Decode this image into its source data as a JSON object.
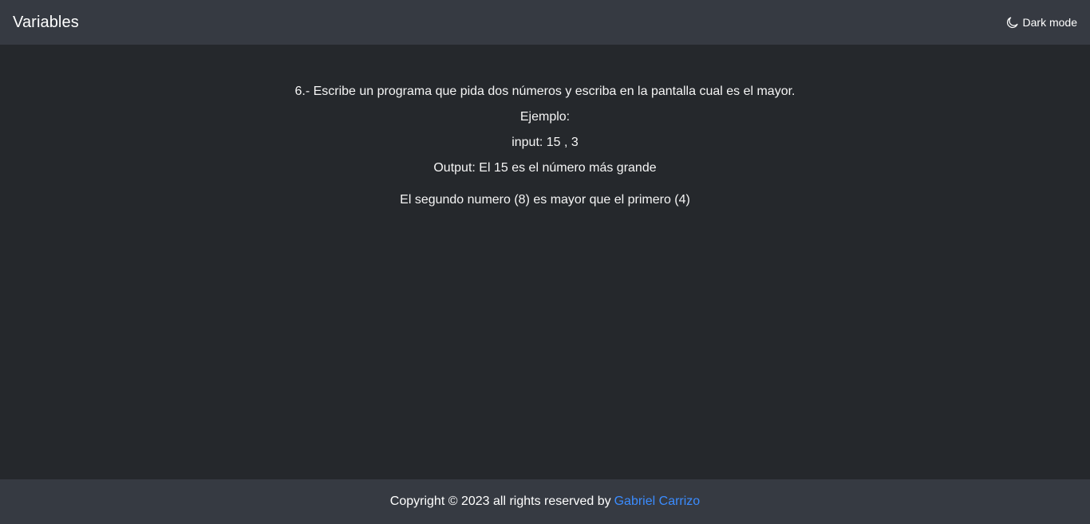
{
  "header": {
    "brand": "Variables",
    "mode_toggle_label": "Dark mode",
    "mode_icon": "moon-icon"
  },
  "main": {
    "statement": "6.- Escribe un programa que pida dos números y escriba en la pantalla cual es el mayor.",
    "example_label": "Ejemplo:",
    "example_input": "input: 15 , 3",
    "example_output": "Output: El 15 es el número más grande",
    "result": "El segundo numero (8) es mayor que el primero (4)"
  },
  "footer": {
    "copyright_text": "Copyright © 2023 all rights reserved by",
    "author_link": "Gabriel Carrizo",
    "link_color": "#3b8cff"
  }
}
